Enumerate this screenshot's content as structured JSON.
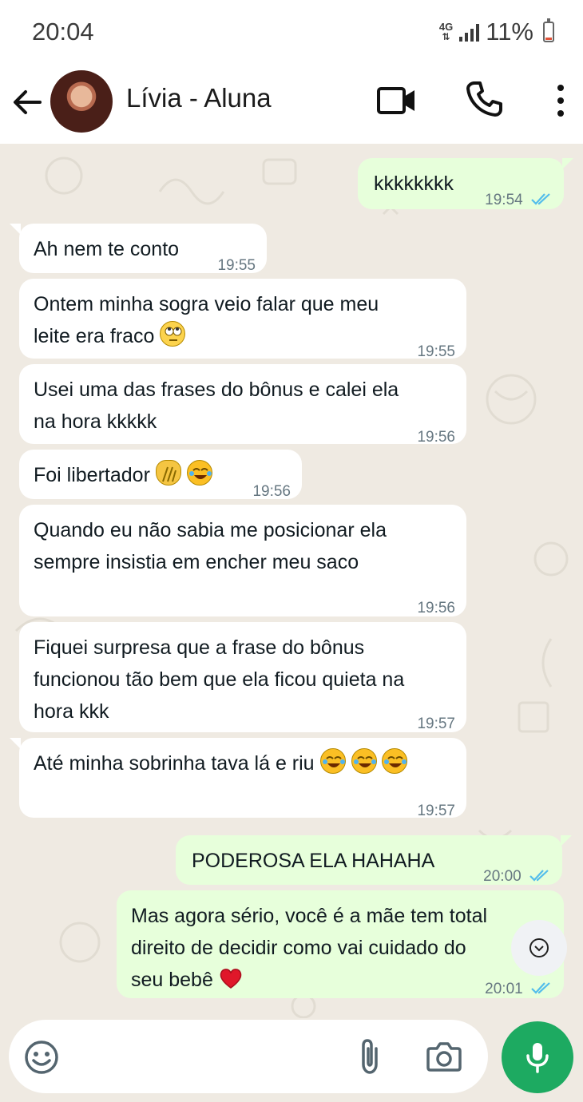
{
  "status_bar": {
    "time": "20:04",
    "network": "4G",
    "battery": "11%"
  },
  "header": {
    "contact_name": "Lívia - Aluna"
  },
  "messages": [
    {
      "dir": "out",
      "text": "kkkkkkkk",
      "time": "19:54",
      "read": true
    },
    {
      "dir": "in",
      "text": "Ah nem te conto",
      "time": "19:55"
    },
    {
      "dir": "in",
      "line1": "Ontem minha sogra veio falar que meu",
      "line2": "leite era fraco",
      "time": "19:55",
      "emoji": "face-with-rolling-eyes"
    },
    {
      "dir": "in",
      "line1": "Usei uma das frases do bônus e calei ela",
      "line2": "na hora kkkkk",
      "time": "19:56"
    },
    {
      "dir": "in",
      "text": "Foi libertador",
      "time": "19:56",
      "emojis": [
        "clapping-hands",
        "face-with-tears-of-joy"
      ]
    },
    {
      "dir": "in",
      "line1": "Quando eu não sabia me posicionar ela",
      "line2": "sempre insistia em encher meu saco",
      "time": "19:56"
    },
    {
      "dir": "in",
      "line1": "Fiquei surpresa que a frase do bônus",
      "line2": "funcionou tão bem que ela ficou quieta na",
      "line3": "hora kkk",
      "time": "19:57"
    },
    {
      "dir": "in",
      "text": "Até minha sobrinha tava lá e riu",
      "time": "19:57",
      "emojis": [
        "face-with-tears-of-joy",
        "face-with-tears-of-joy",
        "face-with-tears-of-joy"
      ]
    },
    {
      "dir": "out",
      "text": "PODEROSA ELA HAHAHA",
      "time": "20:00",
      "read": true
    },
    {
      "dir": "out",
      "line1": "Mas agora sério, você é a mãe tem total",
      "line2": "direito de decidir como vai cuidado do",
      "line3": "seu bebê",
      "time": "20:01",
      "read": true,
      "emoji": "red-heart"
    }
  ],
  "colors": {
    "incoming": "#ffffff",
    "outgoing": "#e7ffdb",
    "accent": "#1daa61",
    "read_ticks": "#53bdeb",
    "chat_bg": "#efeae2"
  },
  "icons": [
    "back-arrow-icon",
    "video-call-icon",
    "phone-icon",
    "more-vert-icon",
    "emoji-icon",
    "attach-icon",
    "camera-icon",
    "mic-icon",
    "scroll-down-icon"
  ]
}
